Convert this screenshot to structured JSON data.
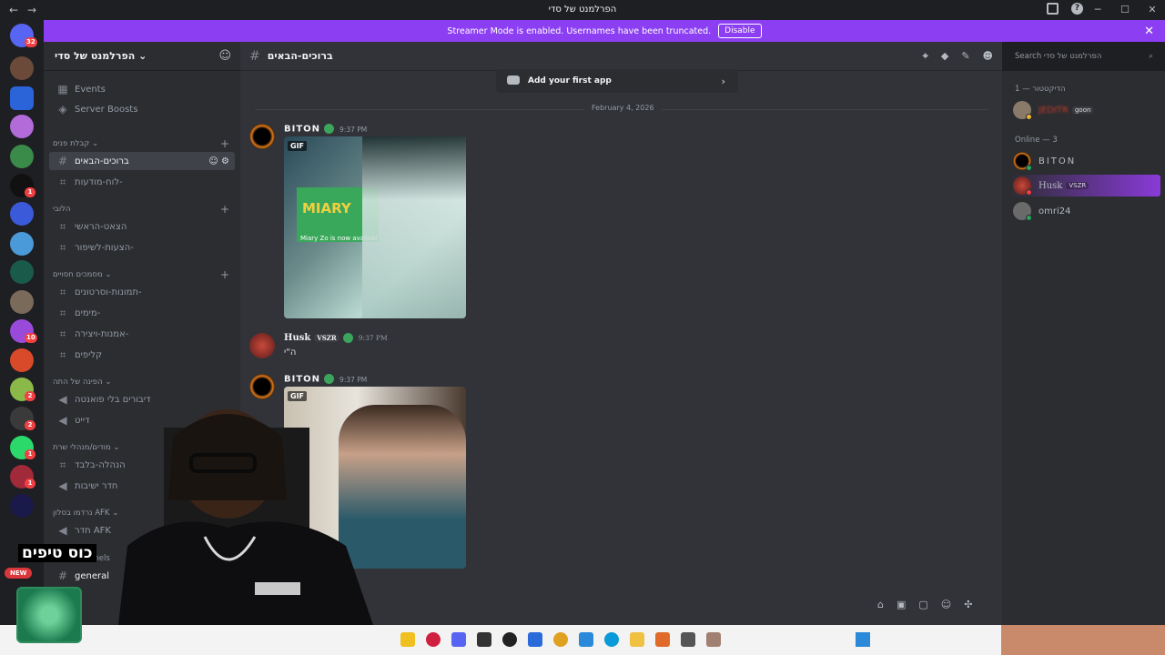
{
  "window": {
    "title": "הפרלמנט של סדי"
  },
  "banner": {
    "text": "Streamer Mode is enabled. Usernames have been truncated.",
    "button": "Disable"
  },
  "guild_badges": {
    "home": "32",
    "g_a": "1",
    "g_b": "10",
    "g_c": "2",
    "g_d": "2",
    "g_e": "1",
    "g_f": "1"
  },
  "server": {
    "name": "הפרלמנט של סדי",
    "top_items": [
      "Events",
      "Server Boosts"
    ]
  },
  "sidebar": {
    "cat1": "קבלת פנים",
    "ch_welcome": "ברוכים-הבאים",
    "ch_board": "לוח-מודעות-",
    "cat2": "הלובי",
    "ch_main": "הצאט-הראשי",
    "ch_suggest": "הצעות-לשיפור-",
    "cat3": "מסמכים חסויים",
    "ch_pics": "תמונות-וסרטונים-",
    "ch_memes": "מימים-",
    "ch_art": "אמנות-ויצירה-",
    "ch_clips": "קליפים",
    "cat4": "הפינה של התה",
    "ch_voice1": "דיבורים בלי פואנטה",
    "ch_voice2": "דייט",
    "cat5": "מודים/מנהלי שרת",
    "ch_admin": "הנהלה-בלבד",
    "ch_meet": "חדר ישיבות",
    "cat6": "נרדמו בסלון AFK",
    "ch_afk": "חדר AFK",
    "cat7": "nnels",
    "ch_general": "general"
  },
  "chat": {
    "channel": "ברוכים-הבאים",
    "search_placeholder": "Search הפרלמנט של סדי",
    "app_card": "Add your first app",
    "date": "February 4, 2026",
    "gif_label": "GIF",
    "gif1_caption": "Miary Zo is now availabl",
    "gif1_brand": "MIARY",
    "messages": [
      {
        "user": "BITON",
        "time": "9:37 PM"
      },
      {
        "user": "Husk",
        "tag": "VSZR",
        "time": "9:37 PM",
        "text": "ה\"י"
      },
      {
        "user": "BITON",
        "time": "9:37 PM"
      }
    ]
  },
  "members": {
    "group1": "הדיקטטור — 1",
    "m1_name": "JEDITR",
    "m1_tag": "goon",
    "group2": "Online — 3",
    "m2": "BITON",
    "m3": "Husk",
    "m3_tag": "VSZR",
    "m4": "omri24"
  },
  "overlay": {
    "caption": "כוס טיפים",
    "new_tag": "NEW"
  },
  "colors": {
    "accent": "#8c3ff2",
    "bg": "#313338",
    "sidebar": "#2b2d31"
  }
}
